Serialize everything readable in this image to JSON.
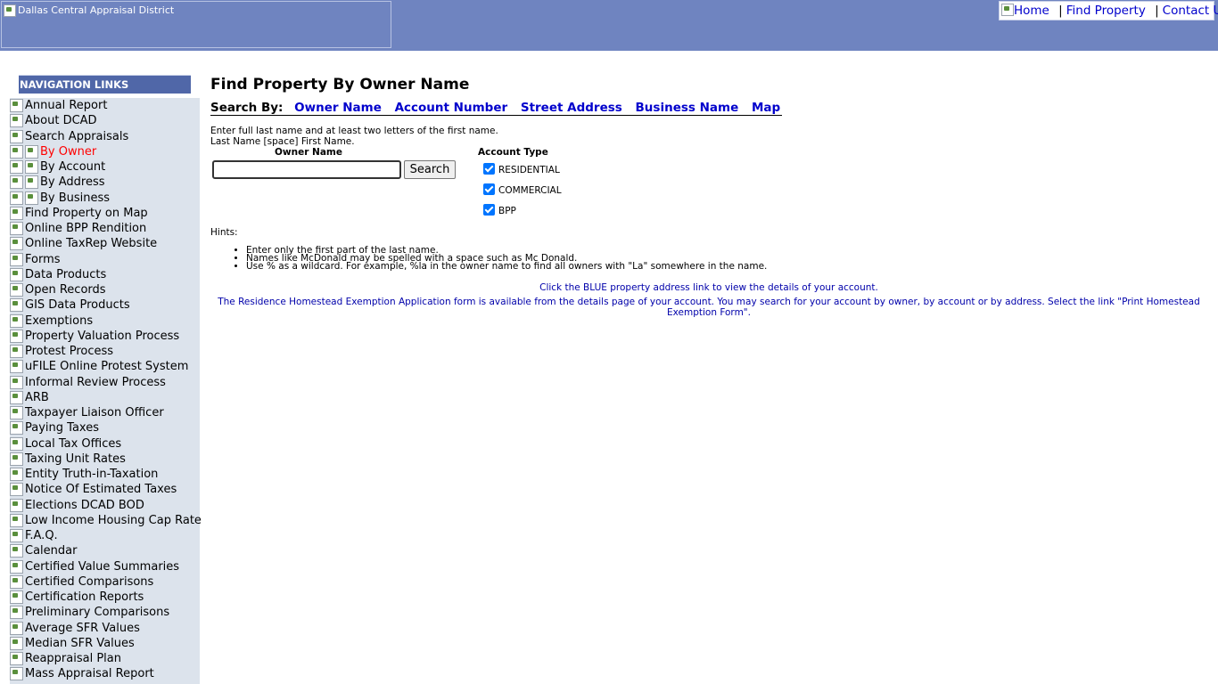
{
  "header": {
    "logo_alt": "Dallas Central Appraisal District",
    "links": [
      {
        "label": "Home"
      },
      {
        "label": "Find Property"
      },
      {
        "label": "Contact Us"
      }
    ],
    "separator": "|",
    "background": "#6f84c0"
  },
  "nav": {
    "header": "NAVIGATION LINKS",
    "items": [
      {
        "label": "Annual Report",
        "sub": false
      },
      {
        "label": "About DCAD",
        "sub": false
      },
      {
        "label": "Search Appraisals",
        "sub": false
      },
      {
        "label": "By Owner",
        "sub": true,
        "active": true
      },
      {
        "label": "By Account",
        "sub": true
      },
      {
        "label": "By Address",
        "sub": true
      },
      {
        "label": "By Business",
        "sub": true
      },
      {
        "label": "Find Property on Map",
        "sub": false
      },
      {
        "label": "Online BPP Rendition",
        "sub": false
      },
      {
        "label": "Online TaxRep Website",
        "sub": false
      },
      {
        "label": "Forms",
        "sub": false
      },
      {
        "label": "Data Products",
        "sub": false
      },
      {
        "label": "Open Records",
        "sub": false
      },
      {
        "label": "GIS Data Products",
        "sub": false
      },
      {
        "label": "Exemptions",
        "sub": false
      },
      {
        "label": "Property Valuation Process",
        "sub": false
      },
      {
        "label": "Protest Process",
        "sub": false
      },
      {
        "label": "uFILE Online Protest System",
        "sub": false
      },
      {
        "label": "Informal Review Process",
        "sub": false
      },
      {
        "label": "ARB",
        "sub": false
      },
      {
        "label": "Taxpayer Liaison Officer",
        "sub": false
      },
      {
        "label": "Paying Taxes",
        "sub": false
      },
      {
        "label": "Local Tax Offices",
        "sub": false
      },
      {
        "label": "Taxing Unit Rates",
        "sub": false
      },
      {
        "label": "Entity Truth-in-Taxation",
        "sub": false
      },
      {
        "label": "Notice Of Estimated Taxes",
        "sub": false
      },
      {
        "label": "Elections DCAD BOD",
        "sub": false
      },
      {
        "label": "Low Income Housing Cap Rate",
        "sub": false
      },
      {
        "label": "F.A.Q.",
        "sub": false
      },
      {
        "label": "Calendar",
        "sub": false
      },
      {
        "label": "Certified Value Summaries",
        "sub": false
      },
      {
        "label": "Certified Comparisons",
        "sub": false
      },
      {
        "label": "Certification Reports",
        "sub": false
      },
      {
        "label": "Preliminary Comparisons",
        "sub": false
      },
      {
        "label": "Average SFR Values",
        "sub": false
      },
      {
        "label": "Median SFR Values",
        "sub": false
      },
      {
        "label": "Reappraisal Plan",
        "sub": false
      },
      {
        "label": "Mass Appraisal Report",
        "sub": false
      }
    ]
  },
  "main": {
    "title": "Find Property By Owner Name",
    "search_by": {
      "label": "Search By:",
      "links": [
        "Owner Name",
        "Account Number",
        "Street Address",
        "Business Name",
        "Map"
      ]
    },
    "instructions": [
      "Enter full last name and at least two letters of the first name.",
      "Last Name [space] First Name."
    ],
    "form": {
      "owner_label": "Owner Name",
      "owner_value": "",
      "search_button": "Search",
      "account_type_label": "Account Type",
      "account_types": [
        {
          "label": "RESIDENTIAL",
          "checked": true
        },
        {
          "label": "COMMERCIAL",
          "checked": true
        },
        {
          "label": "BPP",
          "checked": true
        }
      ]
    },
    "hints_label": "Hints:",
    "hints": [
      "Enter only the first part of the last name.",
      "Names like McDonald may be spelled with a space such as Mc Donald.",
      "Use % as a wildcard. For example, %la in the owner name to find all owners with \"La\" somewhere in the name."
    ],
    "notice1": "Click the BLUE property address link to view the details of your account.",
    "notice2": "The Residence Homestead Exemption Application form is available from the details page of your account. You may search for your account by owner, by account or by address. Select the link \"Print Homestead Exemption Form\"."
  }
}
